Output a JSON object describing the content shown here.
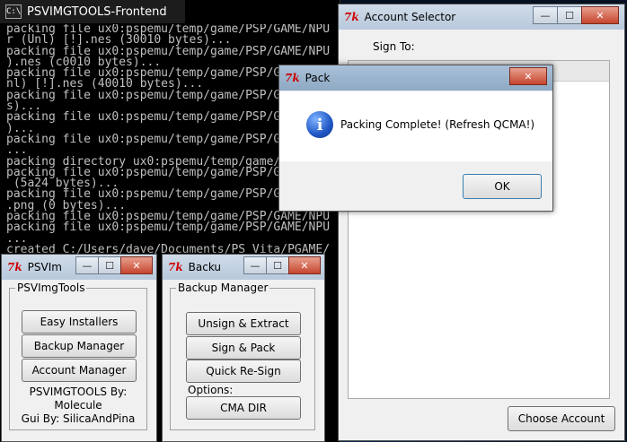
{
  "console": {
    "title": "PSVIMGTOOLS-Frontend",
    "icon_label": "C:\\",
    "lines": [
      "packing file ux0:pspemu/temp/game/PSP/GAME/NPU",
      "r (Unl) [!].nes (30010 bytes)...",
      "packing file ux0:pspemu/temp/game/PSP/GAME/NPU",
      ").nes (c0010 bytes)...",
      "packing file ux0:pspemu/temp/game/PSP/GAME/NPU",
      "nl) [!].nes (40010 bytes)...",
      "packing file ux0:pspemu/temp/game/PSP/GAME/NPU",
      "s)...",
      "packing file ux0:pspemu/temp/game/PSP/GAME/NPU",
      ")...",
      "packing file ux0:pspemu/temp/game/PSP/GAME/NPU",
      "...",
      "packing directory ux0:pspemu/temp/game/PSP/GAM",
      "packing file ux0:pspemu/temp/game/PSP/GAME/NPU",
      " (5a24 bytes)...",
      "packing file ux0:pspemu/temp/game/PSP/GAME/NPU",
      ".png (0 bytes)...",
      "packing file ux0:pspemu/temp/game/PSP/GAME/NPU",
      "packing file ux0:pspemu/temp/game/PSP/GAME/NPU",
      "...",
      "created C:/Users/dave/Documents/PS Vita/PGAME/"
    ]
  },
  "account_selector": {
    "title": "Account Selector",
    "sign_to_label": "Sign To:",
    "choose_button": "Choose Account"
  },
  "pack_dialog": {
    "title": "Pack",
    "message": "Packing Complete! (Refresh QCMA!)",
    "ok_button": "OK"
  },
  "psvimgtools_window": {
    "title": "PSVIm",
    "group_label": "PSVImgTools",
    "buttons": [
      "Easy Installers",
      "Backup Manager",
      "Account Manager"
    ],
    "credit_line1": "PSVIMGTOOLS By:",
    "credit_line2": "Molecule",
    "credit_line3": "Gui By: SilicaAndPina"
  },
  "backup_window": {
    "title": "Backu",
    "group_label": "Backup Manager",
    "buttons": [
      "Unsign & Extract",
      "Sign & Pack",
      "Quick Re-Sign"
    ],
    "options_label": "Options:",
    "cma_button": "CMA DIR"
  },
  "titlebar": {
    "minimize": "—",
    "maximize": "☐",
    "close": "✕",
    "tk_icon": "7k"
  },
  "colors": {
    "console_bg": "#000000",
    "console_text": "#c0c0c0",
    "close_button": "#c6452e",
    "info_icon": "#1f56c4"
  }
}
